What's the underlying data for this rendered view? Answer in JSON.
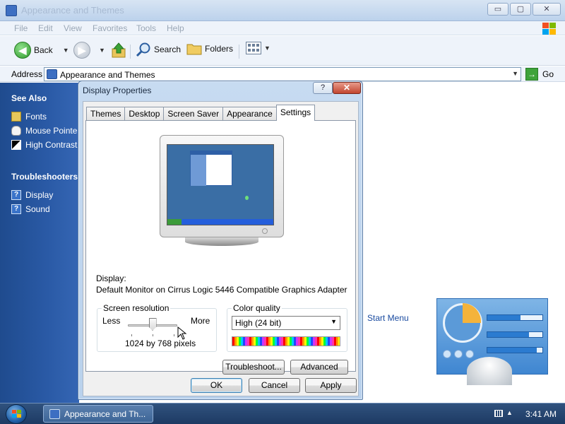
{
  "explorer": {
    "title": "Appearance and Themes",
    "window_controls": {
      "minimize": "▭",
      "maximize": "▢",
      "close": "✕"
    },
    "menu": [
      "File",
      "Edit",
      "View",
      "Favorites",
      "Tools",
      "Help"
    ],
    "toolbar": {
      "back_label": "Back",
      "search_label": "Search",
      "folders_label": "Folders"
    },
    "address": {
      "label": "Address",
      "value": "Appearance and Themes",
      "go_label": "Go"
    },
    "sidebar": {
      "see_also_heading": "See Also",
      "see_also": [
        {
          "label": "Fonts",
          "icon": "fonts-icon"
        },
        {
          "label": "Mouse Pointers",
          "icon": "mouse-icon"
        },
        {
          "label": "High Contrast",
          "icon": "contrast-icon"
        }
      ],
      "troubleshooters_heading": "Troubleshooters",
      "troubleshooters": [
        {
          "label": "Display",
          "icon": "help-icon"
        },
        {
          "label": "Sound",
          "icon": "help-icon"
        }
      ]
    },
    "content_link": "Start Menu"
  },
  "dialog": {
    "title": "Display Properties",
    "help_glyph": "?",
    "close_glyph": "✕",
    "tabs": [
      "Themes",
      "Desktop",
      "Screen Saver",
      "Appearance",
      "Settings"
    ],
    "active_tab": "Settings",
    "display_label": "Display:",
    "display_value": "Default Monitor on Cirrus Logic 5446 Compatible Graphics Adapter",
    "resolution": {
      "group_title": "Screen resolution",
      "less_label": "Less",
      "more_label": "More",
      "value_text": "1024 by 768 pixels",
      "slider_fraction": 0.5
    },
    "color_quality": {
      "group_title": "Color quality",
      "selected": "High (24 bit)"
    },
    "troubleshoot_button": "Troubleshoot...",
    "advanced_button": "Advanced",
    "ok_button": "OK",
    "cancel_button": "Cancel",
    "apply_button": "Apply"
  },
  "taskbar": {
    "task_label": "Appearance and Th...",
    "clock": "3:41 AM"
  },
  "colors": {
    "sidebar_blue": "#2a5aa6",
    "desktop_blue": "#3a6ea5",
    "go_green": "#3ea33a"
  }
}
